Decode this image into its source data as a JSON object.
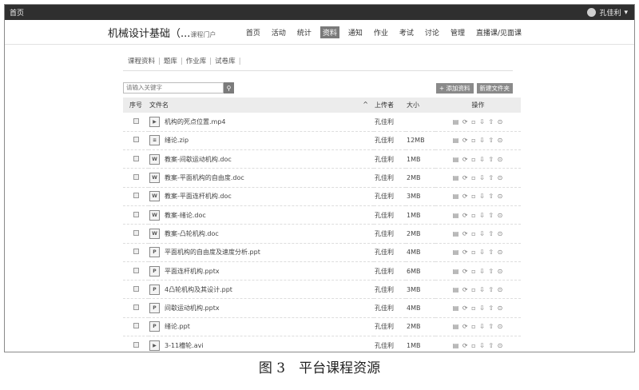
{
  "topbar": {
    "home": "首页",
    "user": "孔佳利"
  },
  "header": {
    "course": "机械设计基础（...",
    "course_suffix": "课程门户",
    "nav": [
      "首页",
      "活动",
      "统计",
      "资料",
      "通知",
      "作业",
      "考试",
      "讨论",
      "管理",
      "直播课/见面课"
    ],
    "active_nav": "资料"
  },
  "subtabs": [
    "课程资料",
    "题库",
    "作业库",
    "试卷库"
  ],
  "search": {
    "placeholder": "请输入关键字"
  },
  "buttons": {
    "add": "+ 添加资料",
    "new_folder": "新建文件夹"
  },
  "table": {
    "headers": {
      "index": "序号",
      "filename": "文件名",
      "uploader": "上传者",
      "size": "大小",
      "actions": "操作"
    },
    "rows": [
      {
        "type": "video",
        "name": "机构的死点位置.mp4",
        "uploader": "孔佳利",
        "size": ""
      },
      {
        "type": "zip",
        "name": "绪论.zip",
        "uploader": "孔佳利",
        "size": "12MB"
      },
      {
        "type": "doc",
        "name": "教案-间歇运动机构.doc",
        "uploader": "孔佳利",
        "size": "1MB"
      },
      {
        "type": "doc",
        "name": "教案-平面机构的自由度.doc",
        "uploader": "孔佳利",
        "size": "2MB"
      },
      {
        "type": "doc",
        "name": "教案-平面连杆机构.doc",
        "uploader": "孔佳利",
        "size": "3MB"
      },
      {
        "type": "doc",
        "name": "教案-绪论.doc",
        "uploader": "孔佳利",
        "size": "1MB"
      },
      {
        "type": "doc",
        "name": "教案-凸轮机构.doc",
        "uploader": "孔佳利",
        "size": "2MB"
      },
      {
        "type": "ppt",
        "name": "平面机构的自由度及速度分析.ppt",
        "uploader": "孔佳利",
        "size": "4MB"
      },
      {
        "type": "ppt",
        "name": "平面连杆机构.pptx",
        "uploader": "孔佳利",
        "size": "6MB"
      },
      {
        "type": "ppt",
        "name": "4凸轮机构及其设计.ppt",
        "uploader": "孔佳利",
        "size": "3MB"
      },
      {
        "type": "ppt",
        "name": "间歇运动机构.pptx",
        "uploader": "孔佳利",
        "size": "4MB"
      },
      {
        "type": "ppt",
        "name": "绪论.ppt",
        "uploader": "孔佳利",
        "size": "2MB"
      },
      {
        "type": "video",
        "name": "3-11槽轮.avi",
        "uploader": "孔佳利",
        "size": "1MB"
      }
    ]
  },
  "caption": "图 3　平台课程资源"
}
